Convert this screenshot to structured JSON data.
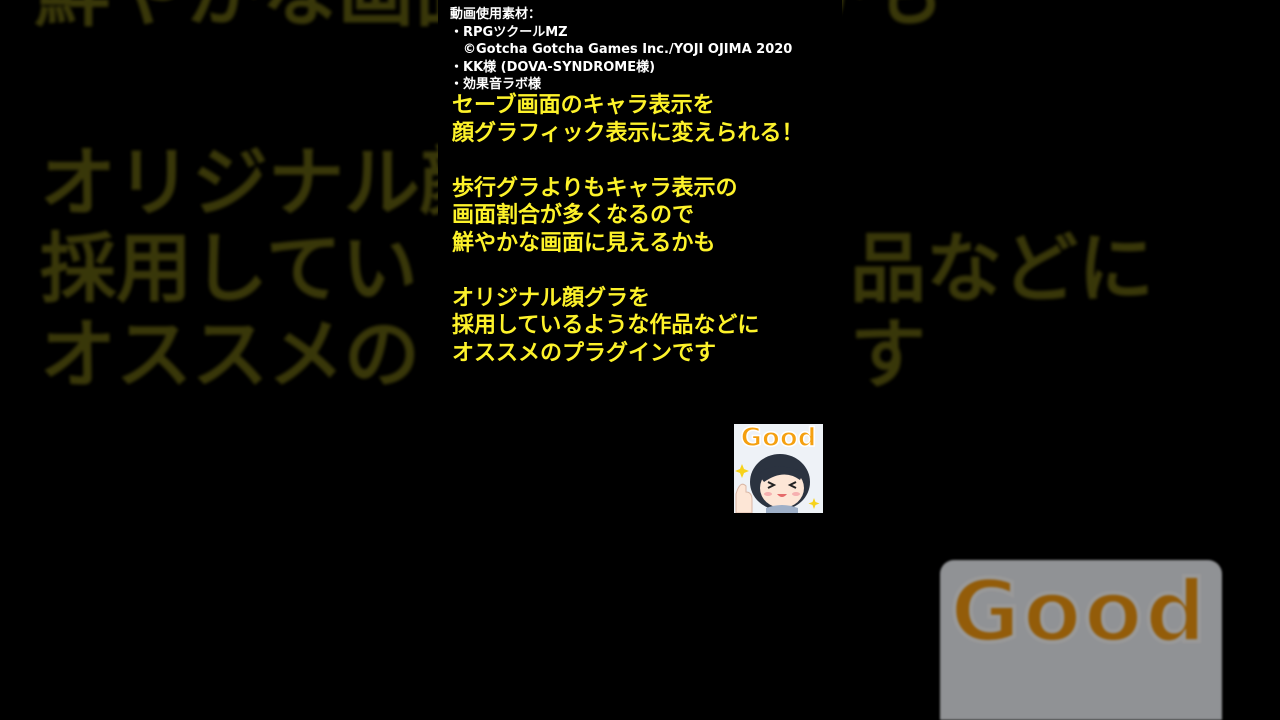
{
  "background": {
    "lines": [
      "オリジナル顔",
      "採用してい",
      "オススメの"
    ],
    "lines_right": [
      "品などに",
      "す"
    ],
    "top_line": "鮮やかな画面に見えるかも",
    "badge_word": "Good"
  },
  "credits": {
    "header": "動画使用素材：",
    "items": [
      "・RPGツクールMZ",
      "　©Gotcha Gotcha Games Inc./YOJI OJIMA 2020",
      "・KK様 (DOVA-SYNDROME様)",
      "・効果音ラボ様"
    ]
  },
  "caption": {
    "paragraphs": [
      [
        "セーブ画面のキャラ表示を",
        "顔グラフィック表示に変えられる！"
      ],
      [
        "歩行グラよりもキャラ表示の",
        "画面割合が多くなるので",
        "鮮やかな画面に見えるかも"
      ],
      [
        "オリジナル顔グラを",
        "採用しているような作品などに",
        "オススメのプラグインです"
      ]
    ]
  },
  "sticker": {
    "word": "Good"
  },
  "colors": {
    "caption": "#fdf22a",
    "credits": "#ffffff",
    "accent_orange": "#f5a010"
  }
}
